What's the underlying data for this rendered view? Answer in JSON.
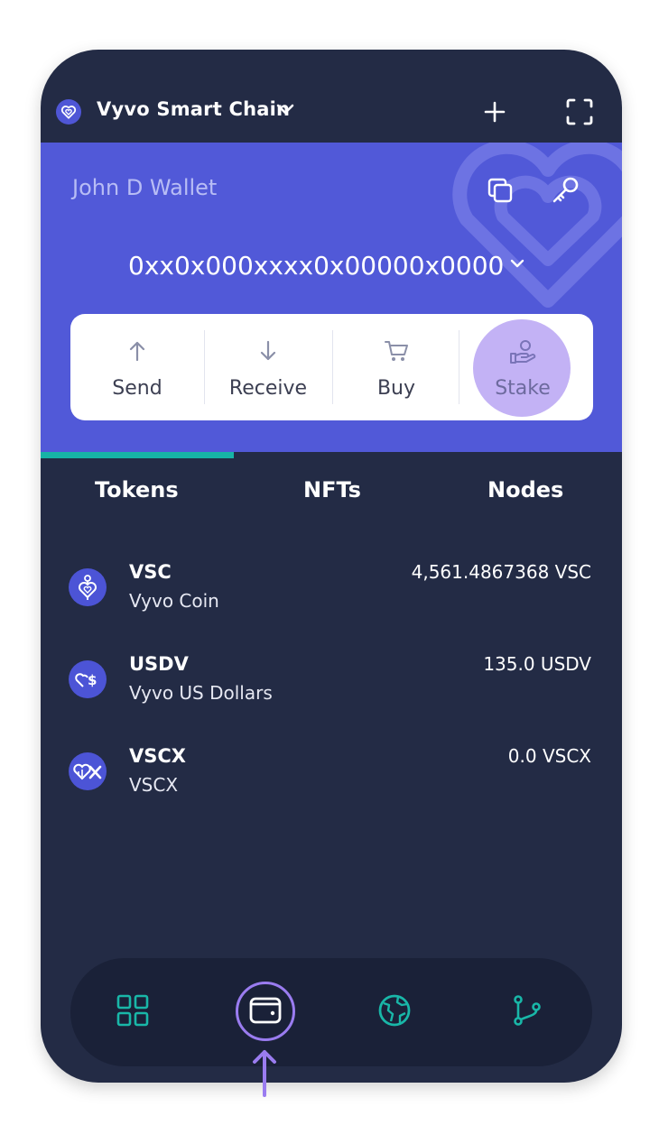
{
  "header": {
    "chain_name": "Vyvo Smart Chain",
    "icons": [
      "vyvo-logo-icon",
      "chevron-down-icon",
      "plus-icon",
      "scan-icon"
    ]
  },
  "wallet": {
    "name": "John D Wallet",
    "address": "0xx0x000xxxx0x00000x0000",
    "icons": [
      "copy-icon",
      "key-icon",
      "heart-watermark-icon"
    ]
  },
  "actions": [
    {
      "label": "Send",
      "icon": "arrow-up-icon"
    },
    {
      "label": "Receive",
      "icon": "arrow-down-icon"
    },
    {
      "label": "Buy",
      "icon": "cart-icon"
    },
    {
      "label": "Stake",
      "icon": "stake-hand-icon",
      "highlighted": true
    }
  ],
  "tabs": [
    {
      "label": "Tokens",
      "active": true
    },
    {
      "label": "NFTs",
      "active": false
    },
    {
      "label": "Nodes",
      "active": false
    }
  ],
  "tokens": [
    {
      "symbol": "VSC",
      "name": "Vyvo Coin",
      "balance": "4,561.4867368 VSC",
      "icon": "vsc-coin-icon"
    },
    {
      "symbol": "USDV",
      "name": "Vyvo US Dollars",
      "balance": "135.0 USDV",
      "icon": "usdv-coin-icon"
    },
    {
      "symbol": "VSCX",
      "name": "VSCX",
      "balance": "0.0 VSCX",
      "icon": "vscx-coin-icon"
    }
  ],
  "bottom_nav": [
    {
      "id": "dashboard",
      "icon": "grid-icon",
      "active": false
    },
    {
      "id": "wallet",
      "icon": "wallet-icon",
      "active": true
    },
    {
      "id": "browser",
      "icon": "globe-icon",
      "active": false
    },
    {
      "id": "nodes",
      "icon": "branch-icon",
      "active": false
    }
  ],
  "colors": {
    "background": "#232b45",
    "card": "#5159d8",
    "accent_teal": "#17b3a6",
    "highlight_purple": "#c3b2f5",
    "ring_purple": "#9a7cf0"
  }
}
